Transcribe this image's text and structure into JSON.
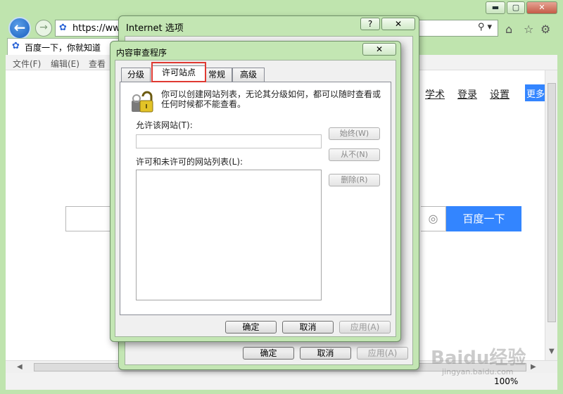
{
  "browser": {
    "address": "https://www",
    "tab_title": "百度一下，你就知道",
    "menu": [
      "文件(F)",
      "编辑(E)",
      "查看"
    ],
    "zoom": "100%"
  },
  "baidu": {
    "links": [
      "学术",
      "登录",
      "设置"
    ],
    "more": "更多",
    "search_button": "百度一下"
  },
  "internet_options": {
    "title": "Internet 选项",
    "help": "?",
    "close": "✕",
    "ok": "确定",
    "cancel": "取消",
    "apply": "应用(A)"
  },
  "content_advisor": {
    "title": "内容审查程序",
    "close": "✕",
    "tabs": [
      "分级",
      "许可站点",
      "常规",
      "高级"
    ],
    "active_tab": "许可站点",
    "description": "你可以创建网站列表，无论其分级如何，都可以随时查看或任何时候都不能查看。",
    "allow_site_label": "允许该网站(T):",
    "allow_site_value": "",
    "list_label": "许可和未许可的网站列表(L):",
    "always_button": "始终(W)",
    "never_button": "从不(N)",
    "remove_button": "删除(R)",
    "ok": "确定",
    "cancel": "取消",
    "apply": "应用(A)"
  },
  "watermark": {
    "main": "Baidu经验",
    "sub": "jingyan.baidu.com"
  }
}
